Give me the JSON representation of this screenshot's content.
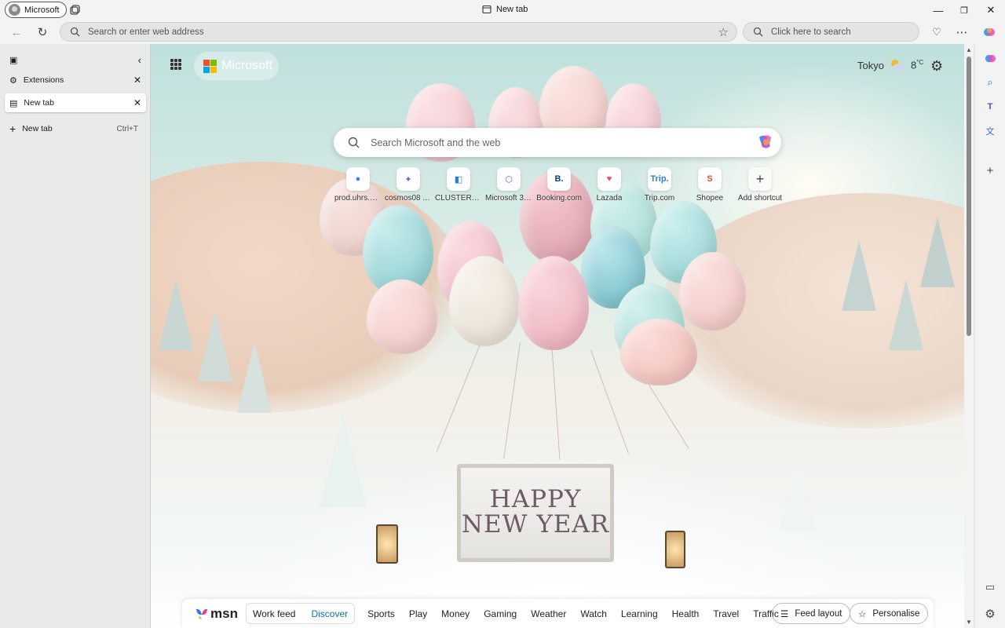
{
  "window": {
    "profile_label": "Microsoft",
    "tab_title": "New tab",
    "minimize_glyph": "—",
    "restore_glyph": "❐",
    "close_glyph": "✕"
  },
  "toolbar": {
    "address_placeholder": "Search or enter web address",
    "search_placeholder": "Click here to search"
  },
  "sidepane": {
    "extensions_label": "Extensions",
    "active_tab_label": "New tab",
    "new_tab_label": "New tab",
    "new_tab_shortcut": "Ctrl+T"
  },
  "newtab": {
    "brand": "Microsoft",
    "city": "Tokyo",
    "temperature": "8",
    "temp_unit": "°C",
    "search_placeholder": "Search Microsoft and the web",
    "sign_line1": "HAPPY",
    "sign_line2": "NEW YEAR",
    "shortcuts": [
      {
        "label": "prod.uhrs.pl...",
        "icon": "globe-icon",
        "glyph": "●",
        "color": "#3b82f6"
      },
      {
        "label": "cosmos08 A...",
        "icon": "cosmos-icon",
        "glyph": "✦",
        "color": "#5b6bbf"
      },
      {
        "label": "CLUSTERED ...",
        "icon": "azure-devops-icon",
        "glyph": "◧",
        "color": "#1f7fd6"
      },
      {
        "label": "Microsoft 365",
        "icon": "m365-icon",
        "glyph": "⬡",
        "color": "#7a5cd6"
      },
      {
        "label": "Booking.com",
        "icon": "booking-icon",
        "glyph": "B.",
        "color": "#0b3a82"
      },
      {
        "label": "Lazada",
        "icon": "lazada-icon",
        "glyph": "♥",
        "color": "#f0466e"
      },
      {
        "label": "Trip.com",
        "icon": "trip-icon",
        "glyph": "Trip.",
        "color": "#2c7be5"
      },
      {
        "label": "Shopee",
        "icon": "shopee-icon",
        "glyph": "S",
        "color": "#ee4d2d"
      },
      {
        "label": "Add shortcut",
        "icon": "plus-icon",
        "glyph": "+",
        "color": "#444444"
      }
    ]
  },
  "msn": {
    "logo_text": "msn",
    "work_feed": "Work feed",
    "discover": "Discover",
    "categories": [
      "Sports",
      "Play",
      "Money",
      "Gaming",
      "Weather",
      "Watch",
      "Learning",
      "Health",
      "Travel",
      "Traffic"
    ],
    "feed_layout": "Feed layout",
    "personalise": "Personalise"
  },
  "colors": {
    "accent": "#0f6cbd",
    "chrome_bg": "#f3f3f3",
    "sidepane_bg": "#e8ebe8"
  }
}
